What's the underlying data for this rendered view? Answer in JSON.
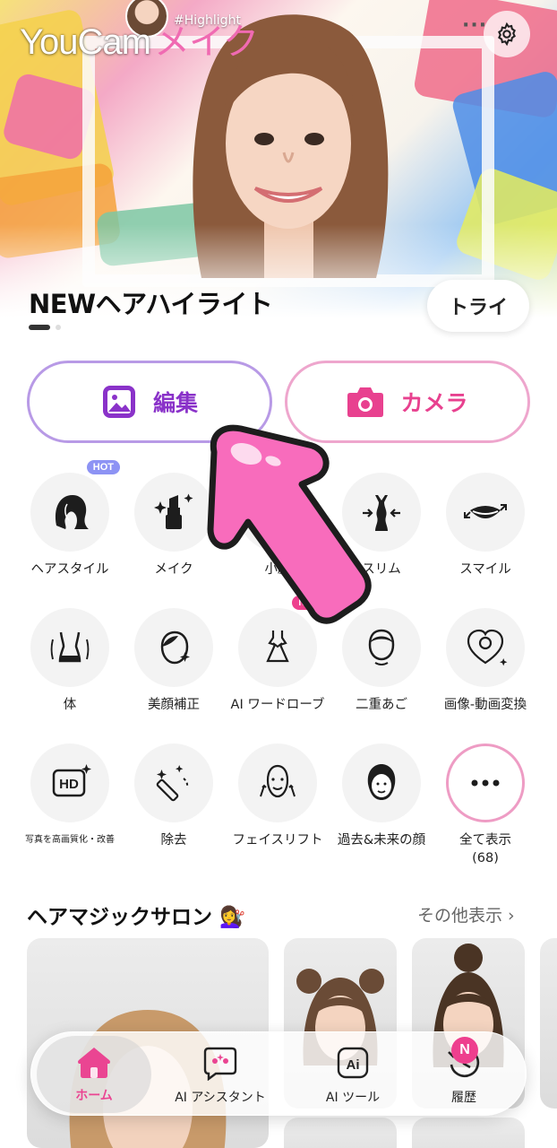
{
  "app": {
    "logo_part1": "YouCam",
    "logo_part2": "メイク"
  },
  "hero": {
    "tag_text": "#Highlight",
    "title": "NEWヘアハイライト",
    "try_label": "トライ",
    "slide_index": 1,
    "slide_count": 2
  },
  "top_bar": {
    "more_icon": "more-horizontal-icon",
    "settings_icon": "gear-icon"
  },
  "actions": {
    "edit_label": "編集",
    "edit_icon": "image-icon",
    "camera_label": "カメラ",
    "camera_icon": "camera-icon"
  },
  "features": [
    {
      "label": "ヘアスタイル",
      "icon": "hair-icon",
      "badge": "HOT"
    },
    {
      "label": "メイク",
      "icon": "lipstick-icon"
    },
    {
      "label": "小顔",
      "icon": "small-face-icon"
    },
    {
      "label": "スリム",
      "icon": "slim-body-icon"
    },
    {
      "label": "スマイル",
      "icon": "smile-lips-icon"
    },
    {
      "label": "体",
      "icon": "body-shape-icon"
    },
    {
      "label": "美顔補正",
      "icon": "face-retouch-icon"
    },
    {
      "label": "AI ワードローブ",
      "icon": "dress-icon",
      "badge": "NEW"
    },
    {
      "label": "二重あご",
      "icon": "double-chin-icon"
    },
    {
      "label": "画像-動画変換",
      "icon": "heart-video-icon"
    },
    {
      "label": "写真を高画質化・改善",
      "icon": "hd-icon"
    },
    {
      "label": "除去",
      "icon": "eraser-wand-icon"
    },
    {
      "label": "フェイスリフト",
      "icon": "face-lift-icon"
    },
    {
      "label": "過去&未来の顔",
      "icon": "aging-face-icon"
    },
    {
      "label": "全て表示\n(68)",
      "icon": "more-dots-icon"
    }
  ],
  "salon": {
    "title": "ヘアマジックサロン",
    "emoji": "💇‍♀️",
    "see_more": "その他表示 ›"
  },
  "nav": [
    {
      "label": "ホーム",
      "icon": "home-icon",
      "active": true
    },
    {
      "label": "AI アシスタント",
      "icon": "ai-assistant-icon"
    },
    {
      "label": "AI ツール",
      "icon": "ai-tools-icon"
    },
    {
      "label": "履歴",
      "icon": "history-icon",
      "badge": "N"
    }
  ],
  "colors": {
    "accent_pink": "#ea4592",
    "accent_purple": "#8a32c9",
    "hot_badge": "#8d93f4",
    "new_badge": "#ee3f8e"
  }
}
